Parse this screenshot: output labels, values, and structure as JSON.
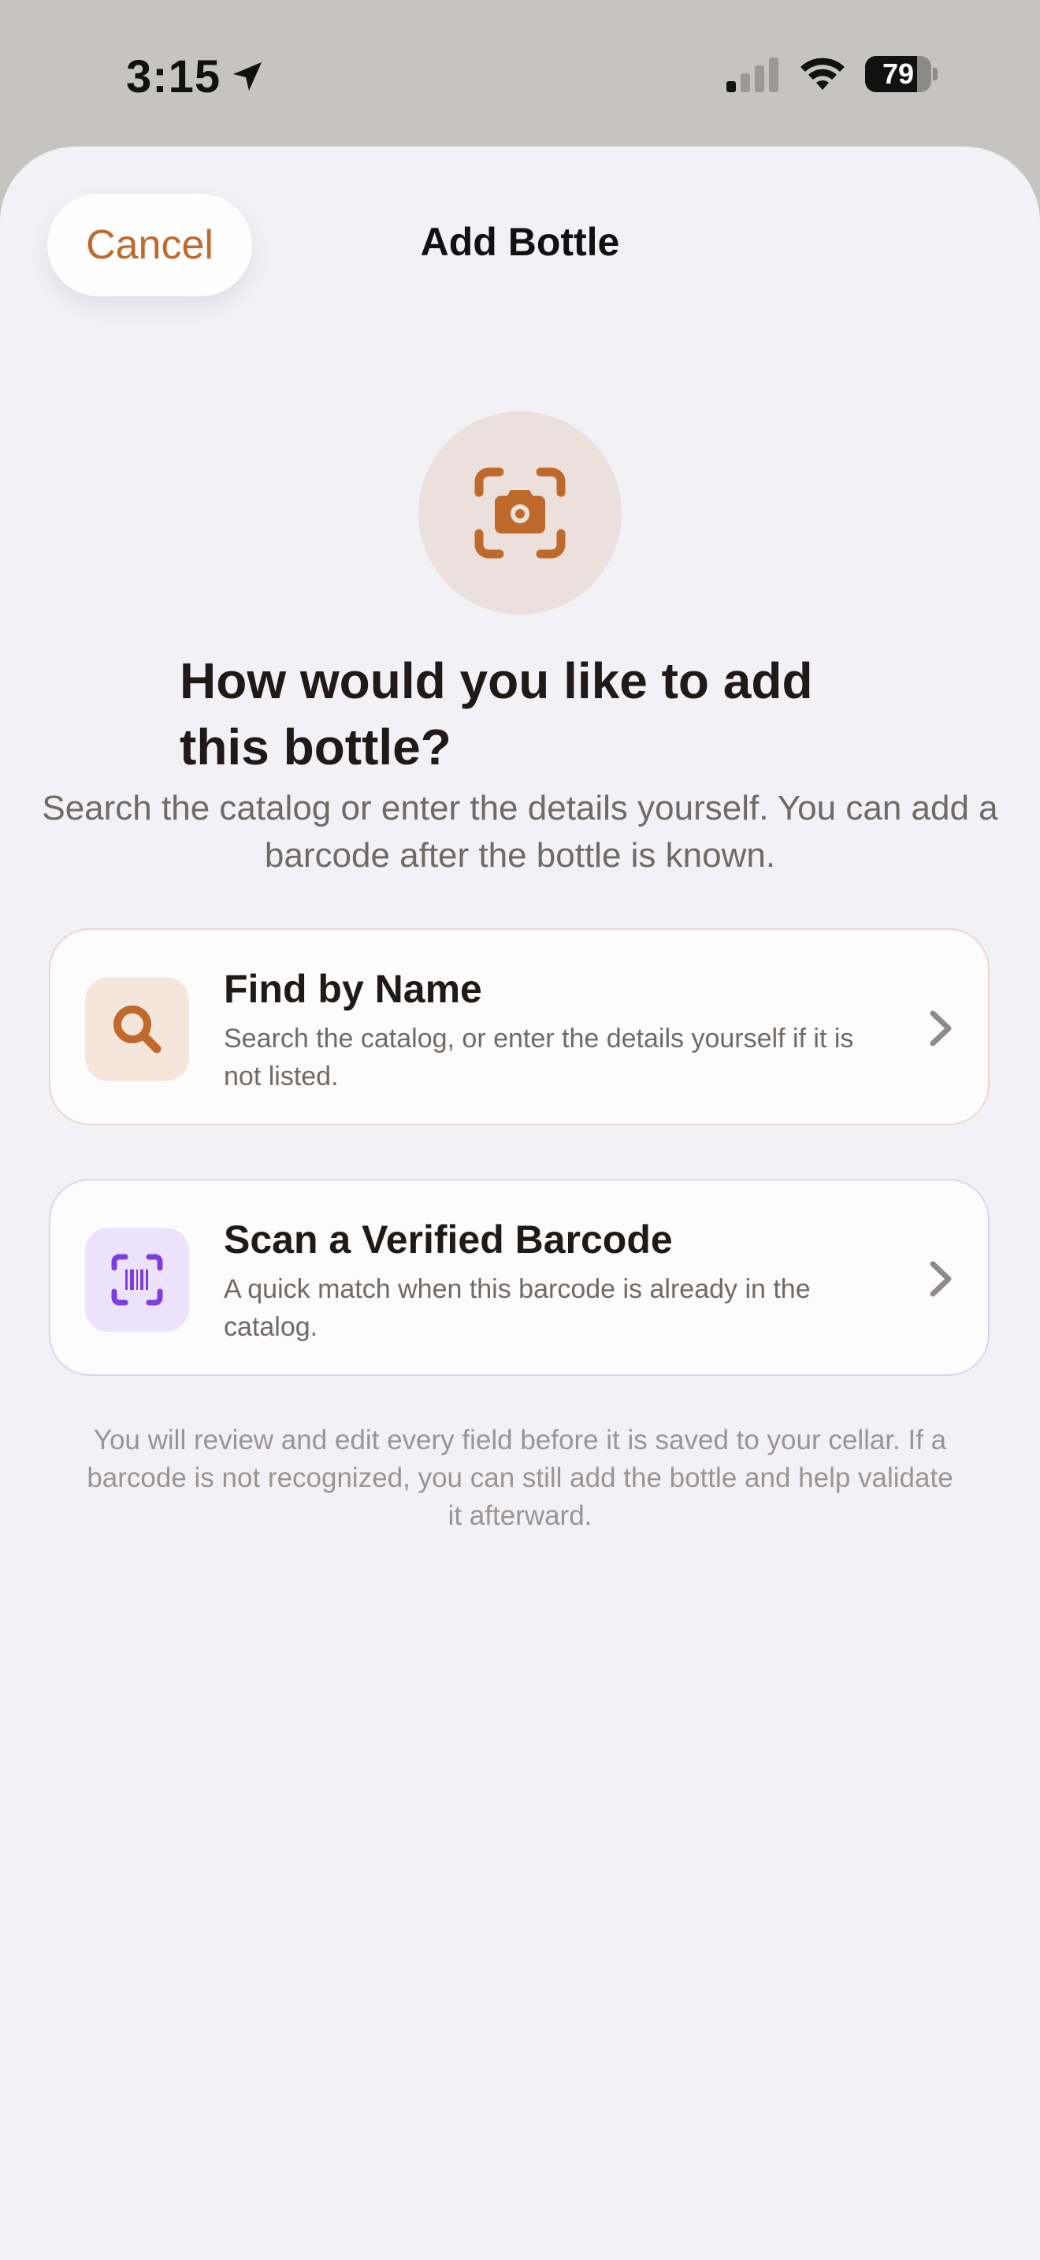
{
  "status_bar": {
    "time": "3:15",
    "battery_level": "79",
    "battery_fraction": 0.79,
    "signal_bars_active": 1,
    "icons": [
      "location-arrow-icon",
      "signal-icon",
      "wifi-icon",
      "battery-icon"
    ]
  },
  "header": {
    "cancel_label": "Cancel",
    "title": "Add Bottle"
  },
  "hero": {
    "icon": "camera-viewfinder-icon",
    "headline": "How would you like to add this bottle?",
    "subtitle": "Search the catalog or enter the details yourself. You can add a barcode after the bottle is known."
  },
  "options": [
    {
      "icon": "magnifying-glass-icon",
      "title": "Find by Name",
      "description": "Search the catalog, or enter the details yourself if it is not listed."
    },
    {
      "icon": "barcode-viewfinder-icon",
      "title": "Scan a Verified Barcode",
      "description": "A quick match when this barcode is already in the catalog."
    }
  ],
  "footnote": "You will review and edit every field before it is saved to your cellar. If a barcode is not recognized, you can still add the bottle and help validate it afterward.",
  "colors": {
    "accent": "#bf6a2c",
    "barcode_accent": "#7b3fe0",
    "sheet_background": "#f2f1f6",
    "backdrop": "#c5c4c0"
  }
}
